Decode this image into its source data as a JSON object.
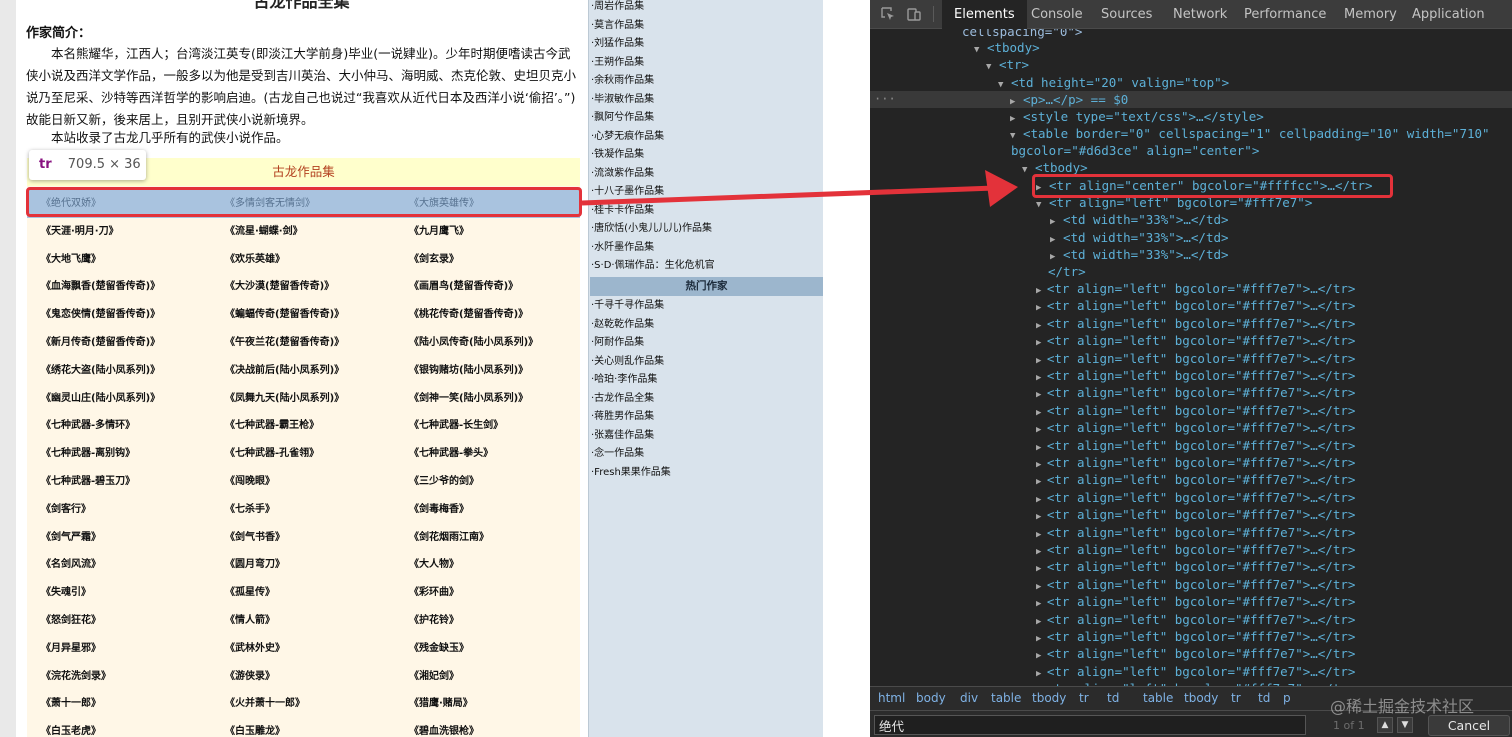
{
  "webpage": {
    "title": "古龙作品全集",
    "author_heading": "作家简介：",
    "author_bio": "本名熊耀华，江西人；台湾淡江英专(即淡江大学前身)毕业(一说肄业)。少年时期便嗜读古今武侠小说及西洋文学作品，一般多以为他是受到吉川英治、大小仲马、海明威、杰克伦敦、史坦贝克小说乃至尼采、沙特等西洋哲学的影响启迪。(古龙自己也说过“我喜欢从近代日本及西洋小说‘偷招’。”) 故能日新又新，後来居上，且别开武侠小说新境界。",
    "site_note": "本站收录了古龙几乎所有的武侠小说作品。",
    "works_header": "古龙作品集",
    "works": [
      [
        "《绝代双娇》",
        "《多情剑客无情剑》",
        "《大旗英雄传》"
      ],
      [
        "《天涯·明月·刀》",
        "《流星·蝴蝶·剑》",
        "《九月鹰飞》"
      ],
      [
        "《大地飞鹰》",
        "《欢乐英雄》",
        "《剑玄录》"
      ],
      [
        "《血海飘香(楚留香传奇)》",
        "《大沙漠(楚留香传奇)》",
        "《画眉鸟(楚留香传奇)》"
      ],
      [
        "《鬼恋侠情(楚留香传奇)》",
        "《蝙蝠传奇(楚留香传奇)》",
        "《桃花传奇(楚留香传奇)》"
      ],
      [
        "《新月传奇(楚留香传奇)》",
        "《午夜兰花(楚留香传奇)》",
        "《陆小凤传奇(陆小凤系列)》"
      ],
      [
        "《绣花大盗(陆小凤系列)》",
        "《决战前后(陆小凤系列)》",
        "《银钩赌坊(陆小凤系列)》"
      ],
      [
        "《幽灵山庄(陆小凤系列)》",
        "《凤舞九天(陆小凤系列)》",
        "《剑神一笑(陆小凤系列)》"
      ],
      [
        "《七种武器-多情环》",
        "《七种武器-霸王枪》",
        "《七种武器-长生剑》"
      ],
      [
        "《七种武器-离别钩》",
        "《七种武器-孔雀翎》",
        "《七种武器-拳头》"
      ],
      [
        "《七种武器-碧玉刀》",
        "《闯晚眼》",
        "《三少爷的剑》"
      ],
      [
        "《剑客行》",
        "《七杀手》",
        "《剑毒梅香》"
      ],
      [
        "《剑气严霜》",
        "《剑气书香》",
        "《剑花烟雨江南》"
      ],
      [
        "《名剑风流》",
        "《圆月弯刀》",
        "《大人物》"
      ],
      [
        "《失魂引》",
        "《孤星传》",
        "《彩环曲》"
      ],
      [
        "《怒剑狂花》",
        "《情人箭》",
        "《护花铃》"
      ],
      [
        "《月异星邪》",
        "《武林外史》",
        "《残金缺玉》"
      ],
      [
        "《浣花洗剑录》",
        "《游侠录》",
        "《湘妃剑》"
      ],
      [
        "《萧十一郎》",
        "《火并萧十一郎》",
        "《猎鹰·赌局》"
      ],
      [
        "《白玉老虎》",
        "《白玉雕龙》",
        "《碧血洗银枪》"
      ]
    ],
    "inspect_tooltip": {
      "tag": "tr",
      "dims": "709.5 × 36"
    },
    "sidebar_top": [
      "·周岩作品集",
      "·莫言作品集",
      "·刘猛作品集",
      "·王朔作品集",
      "·余秋雨作品集",
      "·毕淑敏作品集",
      "·飘阿兮作品集",
      "·心梦无痕作品集",
      "·铁凝作品集",
      "·流潋紫作品集",
      "·十八子墨作品集",
      "·桂卡卡作品集",
      "·唐欣恬(小鬼儿儿儿)作品集",
      "·水阡墨作品集",
      "·S·D·佩瑞作品：生化危机官"
    ],
    "sidebar_hot_heading": "热门作家",
    "sidebar_hot": [
      "·千寻千寻作品集",
      "·赵乾乾作品集",
      "·阿耐作品集",
      "·关心则乱作品集",
      "·哈珀·李作品集",
      "·古龙作品全集",
      "·蒋胜男作品集",
      "·张嘉佳作品集",
      "·念一作品集",
      "·Fresh果果作品集"
    ]
  },
  "devtools": {
    "tabs": [
      "Elements",
      "Console",
      "Sources",
      "Network",
      "Performance",
      "Memory",
      "Application"
    ],
    "active_tab": "Elements",
    "tree_text": {
      "cellspacing_line": "cellspacing=\"0\">",
      "tbody": "<tbody>",
      "tr": "<tr>",
      "td": "<td height=\"20\" valign=\"top\">",
      "p": "<p>…</p> == $0",
      "style": "<style type=\"text/css\">…</style>",
      "table1": "<table border=\"0\" cellspacing=\"1\" cellpadding=\"10\" width=\"710\"",
      "table2": "bgcolor=\"#d6d3ce\" align=\"center\">",
      "tbody2": "<tbody>",
      "tr_center": "<tr align=\"center\" bgcolor=\"#ffffcc\">…</tr>",
      "tr_open": "<tr align=\"left\" bgcolor=\"#fff7e7\">",
      "td33": "<td width=\"33%\">…</td>",
      "tr_close": "</tr>",
      "tr_left": "<tr align=\"left\" bgcolor=\"#fff7e7\">…</tr>"
    },
    "breadcrumbs": [
      "html",
      "body",
      "div",
      "table",
      "tbody",
      "tr",
      "td",
      "table",
      "tbody",
      "tr",
      "td",
      "p"
    ],
    "search_value": "绝代",
    "search_count": "1 of 1",
    "cancel_label": "Cancel",
    "watermark": "@稀土掘金技术社区"
  },
  "colors": {
    "highlight_red": "#e3323a",
    "row_header_bg": "#ffffcc",
    "row_bg": "#fff7e7",
    "sidebar_bg": "#d9e3ec"
  }
}
